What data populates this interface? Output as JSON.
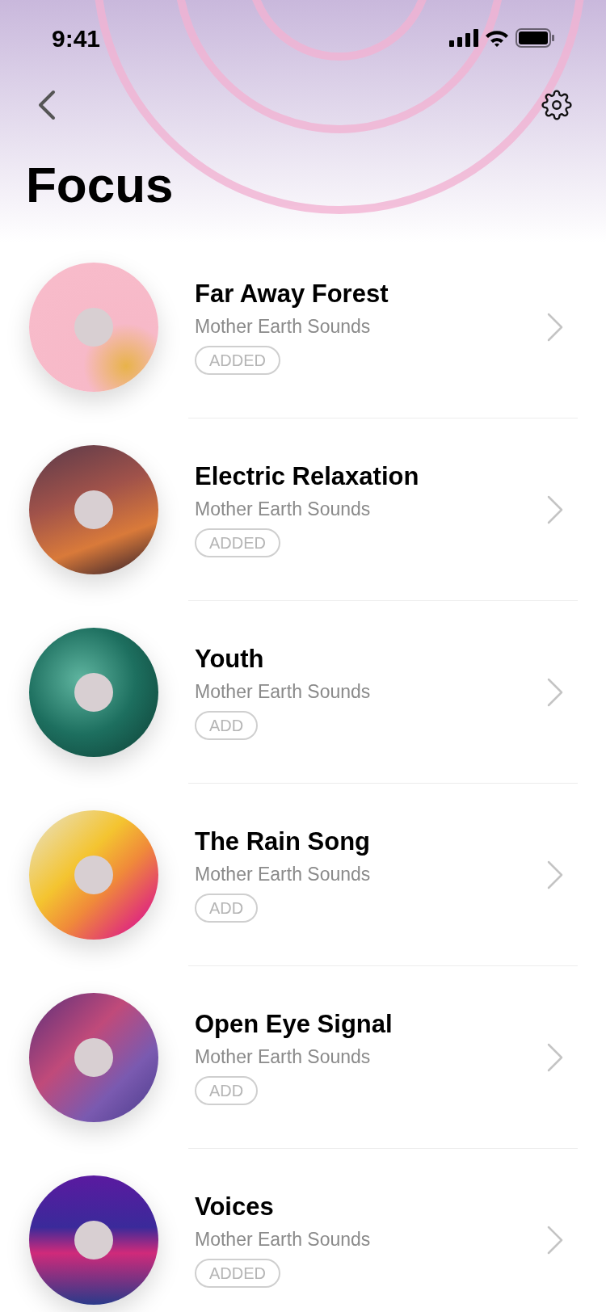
{
  "status_bar": {
    "time": "9:41"
  },
  "header": {
    "title": "Focus"
  },
  "tracks": [
    {
      "title": "Far Away Forest",
      "artist": "Mother Earth Sounds",
      "badge": "ADDED"
    },
    {
      "title": "Electric Relaxation",
      "artist": "Mother Earth Sounds",
      "badge": "ADDED"
    },
    {
      "title": "Youth",
      "artist": "Mother Earth Sounds",
      "badge": "ADD"
    },
    {
      "title": "The Rain Song",
      "artist": "Mother Earth Sounds",
      "badge": "ADD"
    },
    {
      "title": "Open Eye Signal",
      "artist": "Mother Earth Sounds",
      "badge": "ADD"
    },
    {
      "title": "Voices",
      "artist": "Mother Earth Sounds",
      "badge": "ADDED"
    }
  ]
}
